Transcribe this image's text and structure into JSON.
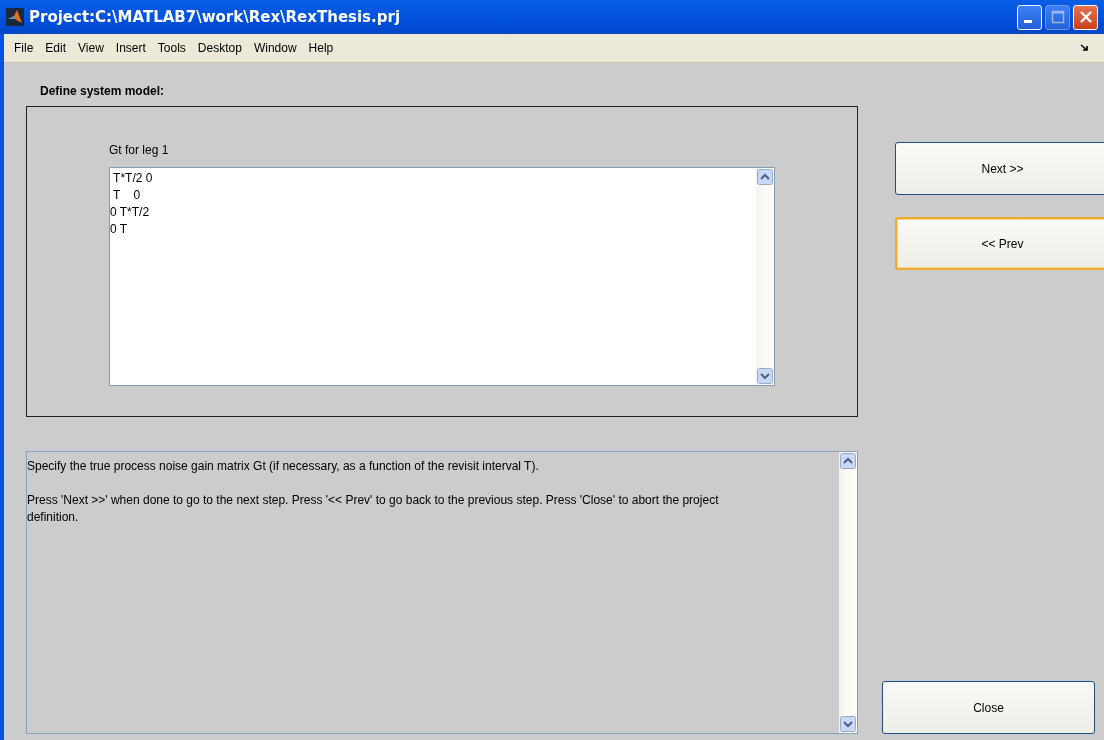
{
  "window": {
    "title": "Project:C:\\MATLAB7\\work\\Rex\\RexThesis.prj"
  },
  "menu": [
    "File",
    "Edit",
    "View",
    "Insert",
    "Tools",
    "Desktop",
    "Window",
    "Help"
  ],
  "heading": "Define system model:",
  "matrix": {
    "label": "Gt for  leg 1",
    "lines": [
      " T*T/2 0",
      " T    0",
      "0 T*T/2",
      "0 T"
    ]
  },
  "help": [
    "Specify the true process noise gain matrix Gt (if necessary, as a function of the revisit interval T).",
    "Press 'Next >>' when done to go to the next step. Press '<< Prev' to go back to the previous step. Press 'Close' to abort the project definition."
  ],
  "buttons": [
    {
      "label": "Next >>",
      "focused": false
    },
    {
      "label": "<< Prev",
      "focused": true
    }
  ],
  "close_button": {
    "label": "Close",
    "focused": false
  }
}
